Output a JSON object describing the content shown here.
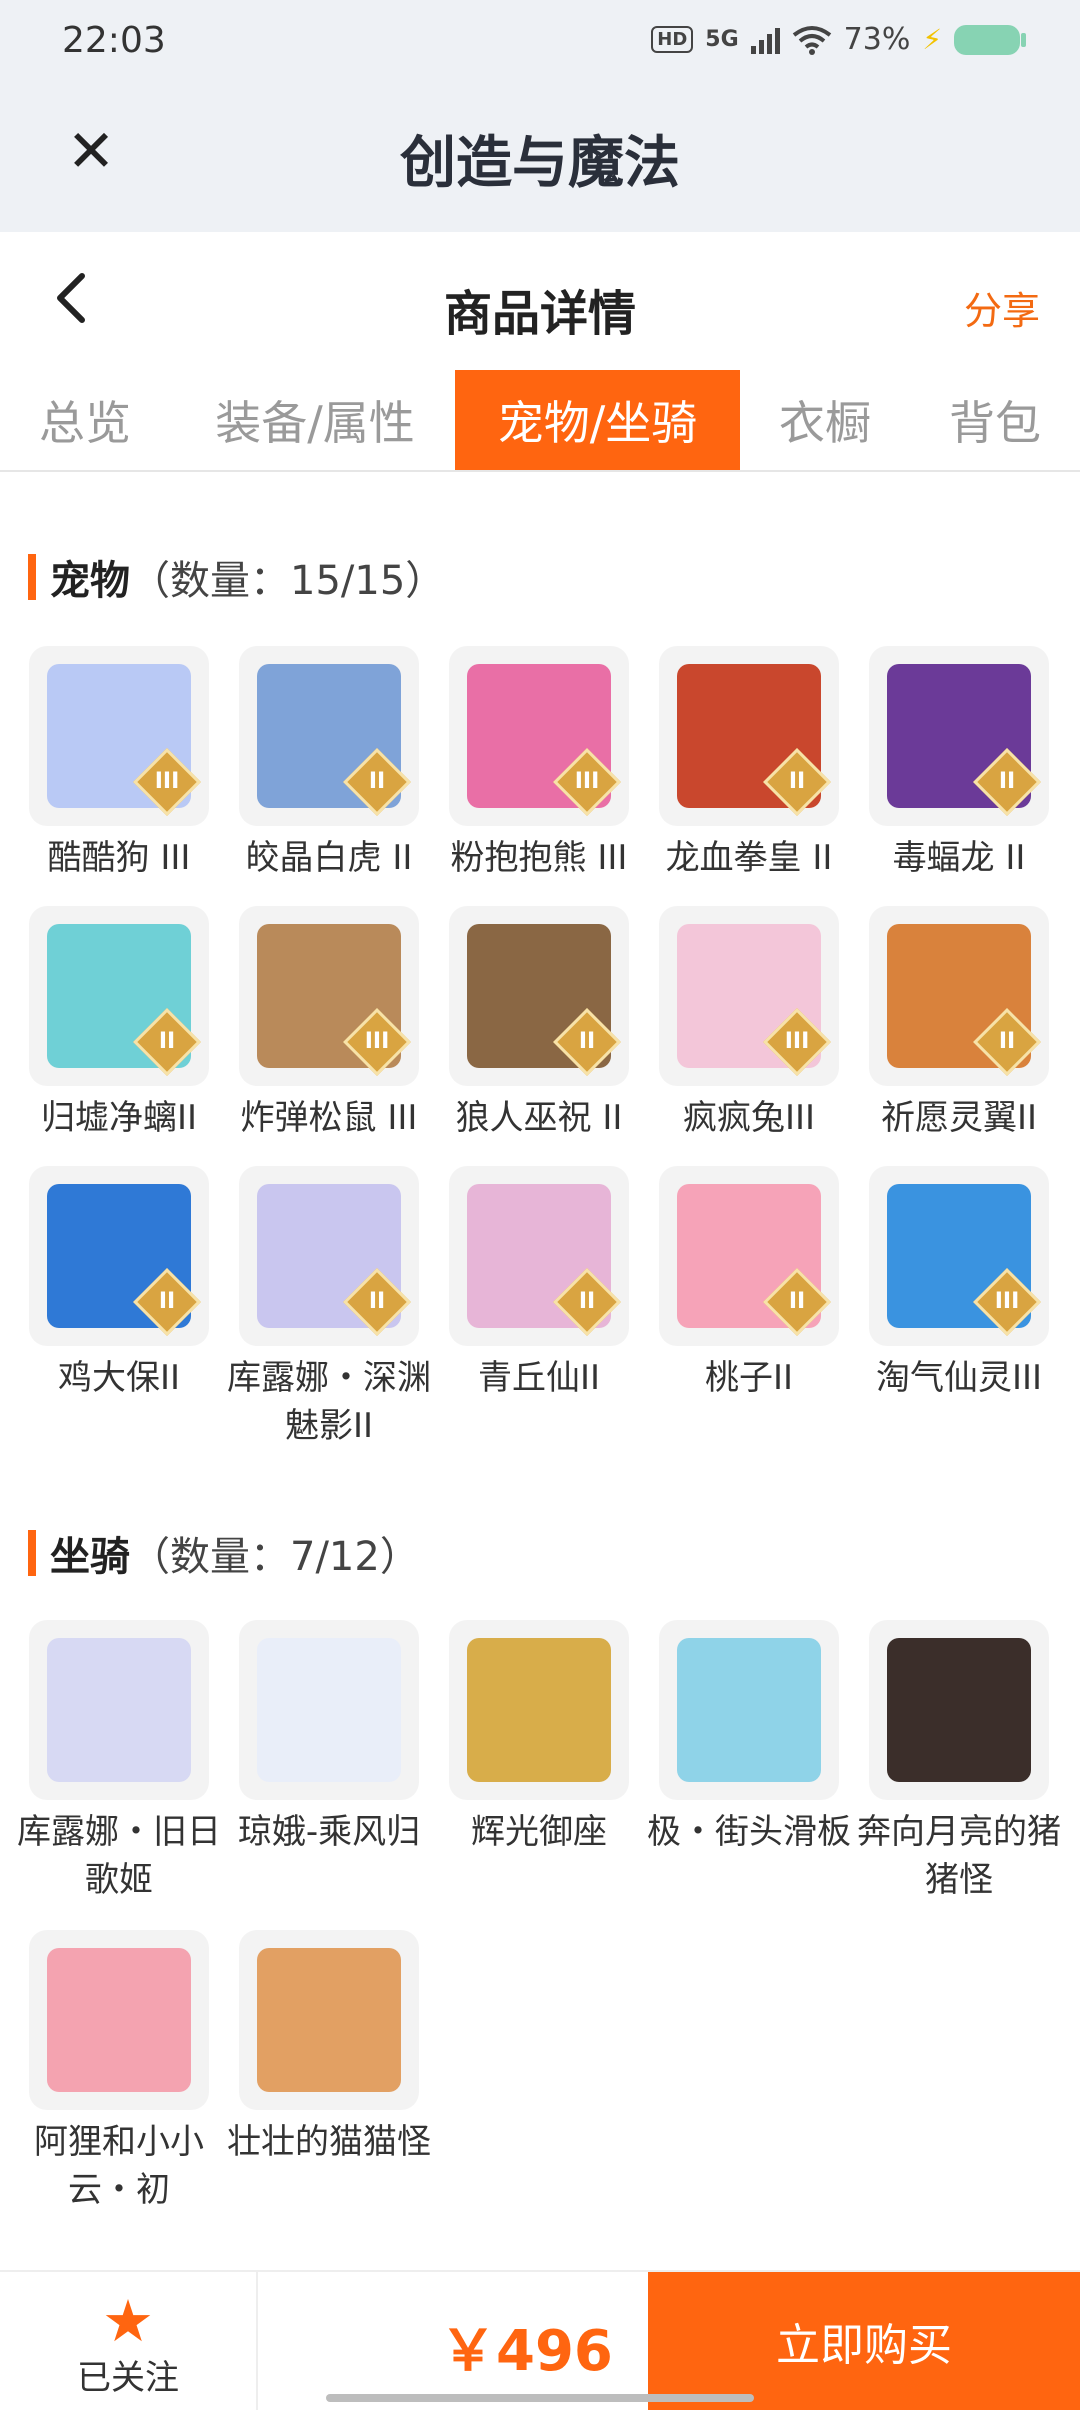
{
  "status_bar": {
    "time": "22:03",
    "network": "5G",
    "battery": "73%",
    "hd_label": "HD",
    "icons": [
      "signal-icon",
      "wifi-icon",
      "battery-icon",
      "charging-icon"
    ]
  },
  "app": {
    "title": "创造与魔法",
    "close_icon": "close-icon"
  },
  "header": {
    "title": "商品详情",
    "share_label": "分享",
    "back_icon": "chevron-left-icon"
  },
  "tabs": [
    {
      "label": "总览",
      "active": false
    },
    {
      "label": "装备/属性",
      "active": false
    },
    {
      "label": "宠物/坐骑",
      "active": true
    },
    {
      "label": "衣橱",
      "active": false
    },
    {
      "label": "背包",
      "active": false
    }
  ],
  "pets": {
    "title": "宠物",
    "count": "（数量：15/15）",
    "items": [
      {
        "name": "酷酷狗 III",
        "tier": "III",
        "color": "#b9c9f5"
      },
      {
        "name": "皎晶白虎 II",
        "tier": "II",
        "color": "#7fa3d8"
      },
      {
        "name": "粉抱抱熊 III",
        "tier": "III",
        "color": "#e96fa6"
      },
      {
        "name": "龙血拳皇 II",
        "tier": "II",
        "color": "#c9472d"
      },
      {
        "name": "毒蝠龙 II",
        "tier": "II",
        "color": "#6b3a98"
      },
      {
        "name": "归墟净螭II",
        "tier": "II",
        "color": "#6fd0d6"
      },
      {
        "name": "炸弹松鼠 III",
        "tier": "III",
        "color": "#b98a5a"
      },
      {
        "name": "狼人巫祝 II",
        "tier": "II",
        "color": "#8a6744"
      },
      {
        "name": "疯疯兔III",
        "tier": "III",
        "color": "#f3c6d9"
      },
      {
        "name": "祈愿灵翼II",
        "tier": "II",
        "color": "#d9823c"
      },
      {
        "name": "鸡大保II",
        "tier": "II",
        "color": "#2f79d6"
      },
      {
        "name": "库露娜・深渊魅影II",
        "tier": "II",
        "color": "#c9c6ef"
      },
      {
        "name": "青丘仙II",
        "tier": "II",
        "color": "#e7b5d7"
      },
      {
        "name": "桃子II",
        "tier": "II",
        "color": "#f6a3b8"
      },
      {
        "name": "淘气仙灵III",
        "tier": "III",
        "color": "#3a93e0"
      }
    ]
  },
  "mounts": {
    "title": "坐骑",
    "count": "（数量：7/12）",
    "items": [
      {
        "name": "库露娜・旧日歌姬",
        "color": "#d7d9f3"
      },
      {
        "name": "琼娥-乘风归",
        "color": "#e9eef9"
      },
      {
        "name": "辉光御座",
        "color": "#d8ad4a"
      },
      {
        "name": "极・街头滑板",
        "color": "#8fd3e8"
      },
      {
        "name": "奔向月亮的猪猪怪",
        "color": "#3b2e2a"
      },
      {
        "name": "阿狸和小小云・初",
        "color": "#f4a3b0"
      },
      {
        "name": "壮壮的猫猫怪",
        "color": "#e2a063"
      }
    ]
  },
  "bottom_bar": {
    "follow_label": "已关注",
    "follow_icon": "star-icon",
    "price": "￥496",
    "buy_label": "立即购买"
  }
}
